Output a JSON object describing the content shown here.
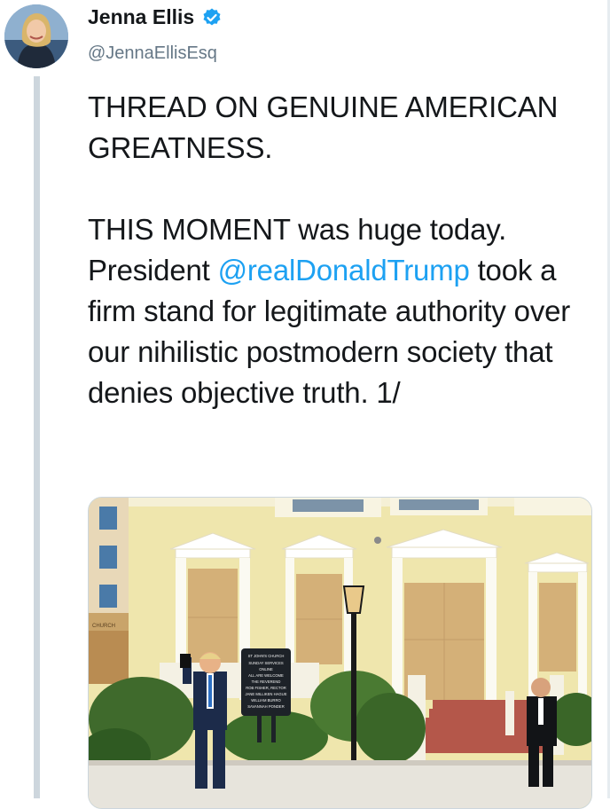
{
  "author": {
    "name": "Jenna Ellis",
    "handle": "@JennaEllisEsq",
    "verified": true
  },
  "tweet": {
    "line1": "THREAD ON GENUINE AMERICAN GREATNESS.",
    "line2_before": "THIS MOMENT was huge today. President ",
    "mention": "@realDonaldTrump",
    "line2_after": " took a firm stand for legitimate authority over our nihilistic postmodern society that denies objective truth. 1/"
  },
  "media": {
    "sign_lines": [
      "ST JOHN'S CHURCH",
      "SUNDAY SERVICES",
      "ONLINE",
      "ALL ARE WELCOME",
      "THE REVEREND",
      "ROB FISHER, RECTOR",
      "JANE MILLIKEN HAGUE",
      "WILLIAM BURRO",
      "SAVANNAH PONDER"
    ],
    "church_label": "CHURCH"
  },
  "colors": {
    "link": "#1da1f2",
    "verified_badge": "#1da1f2",
    "text": "#14171a",
    "secondary": "#657786"
  }
}
